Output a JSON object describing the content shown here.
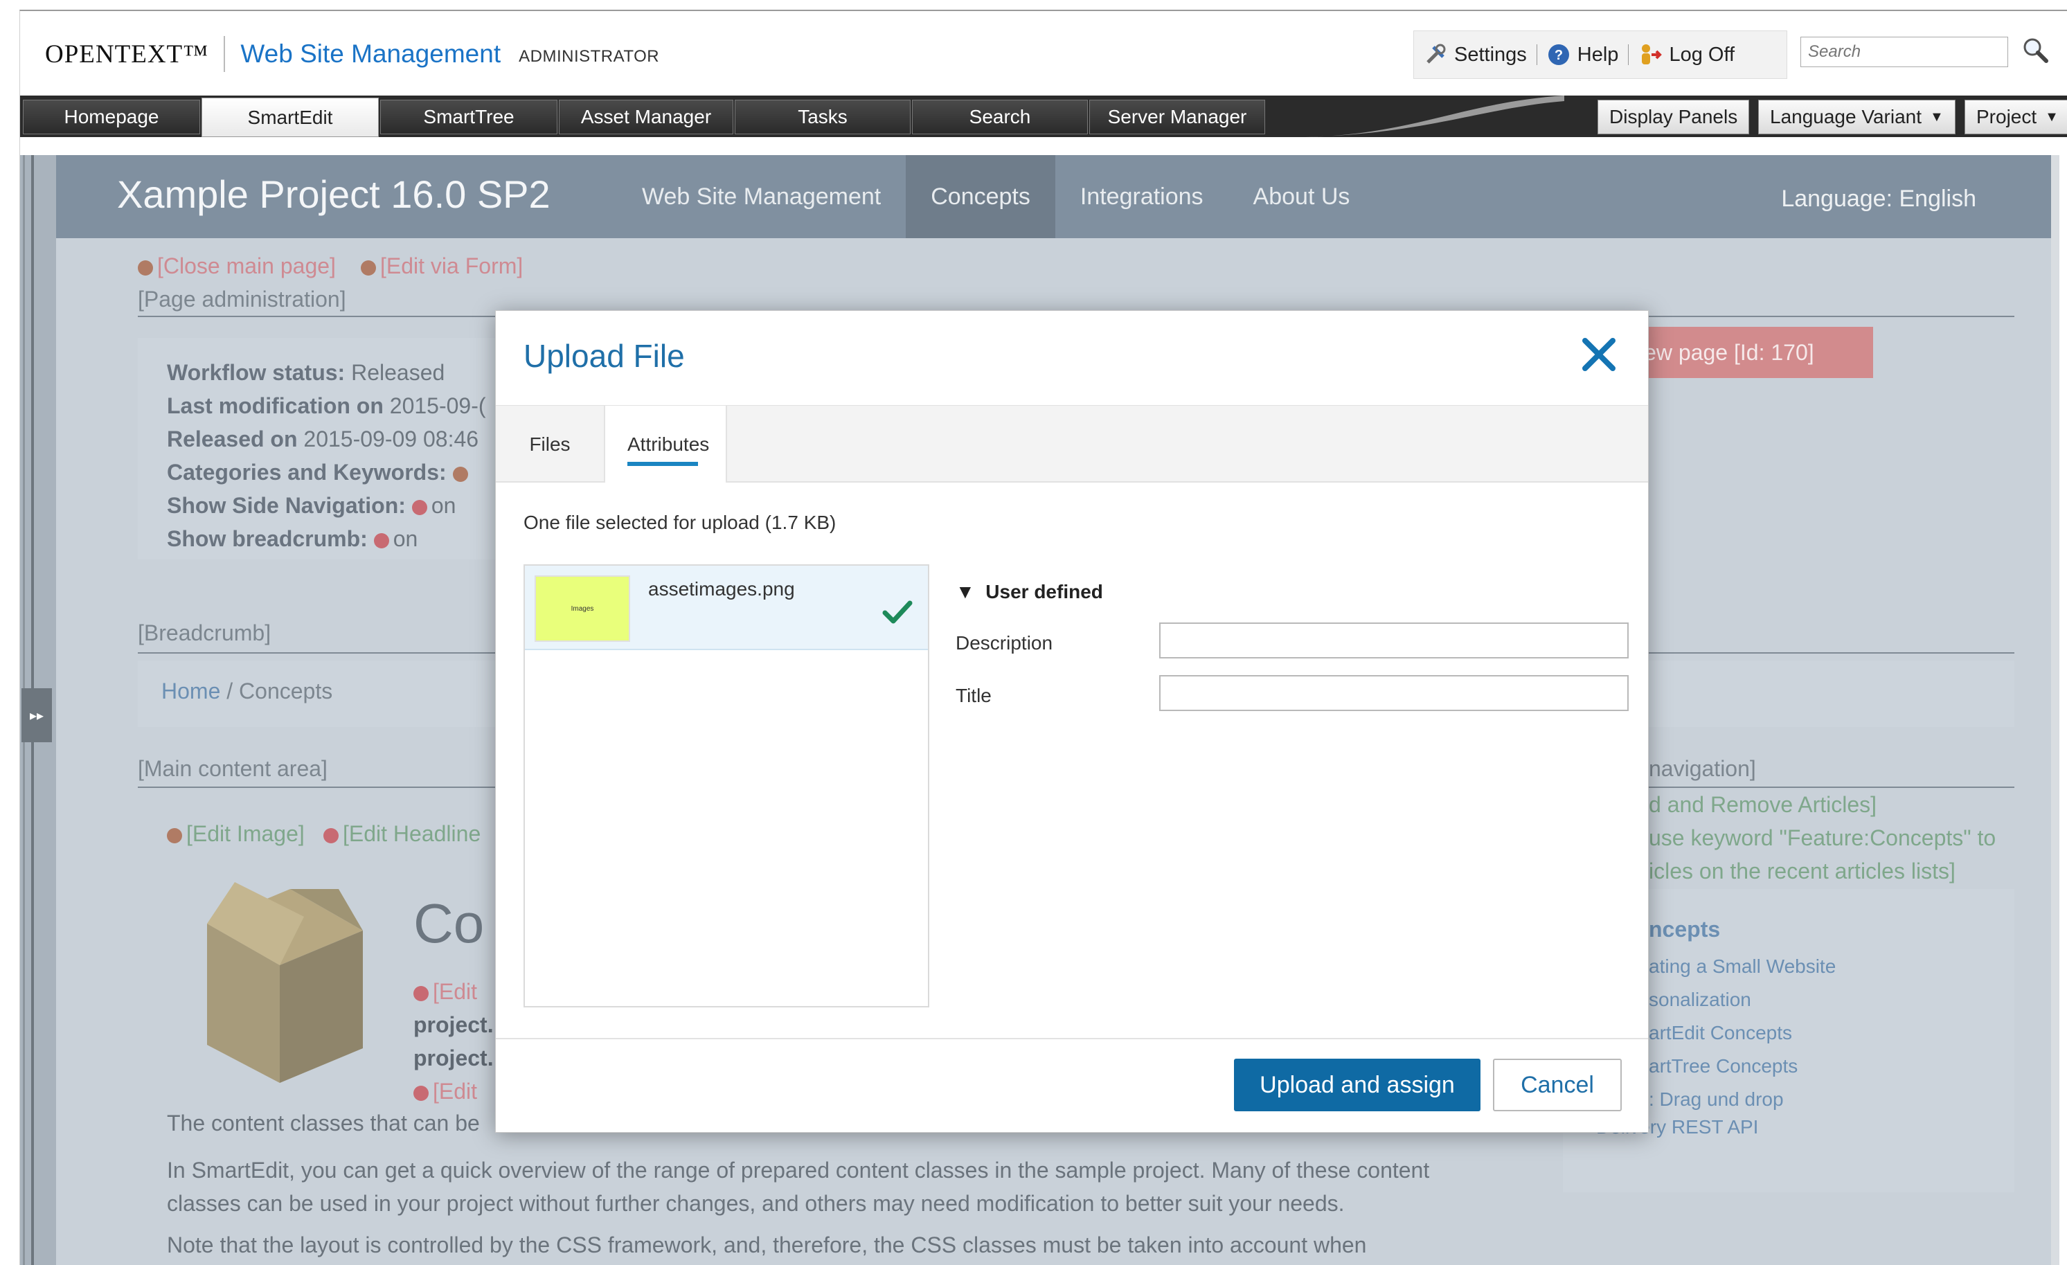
{
  "header": {
    "logo": "OPENTEXT™",
    "product": "Web Site Management",
    "role": "ADMINISTRATOR",
    "tools": [
      {
        "label": "Settings",
        "icon": "settings-icon"
      },
      {
        "label": "Help",
        "icon": "help-icon"
      },
      {
        "label": "Log Off",
        "icon": "logoff-icon"
      }
    ],
    "search_placeholder": "Search"
  },
  "tabs": [
    "Homepage",
    "SmartEdit",
    "SmartTree",
    "Asset Manager",
    "Tasks",
    "Search",
    "Server Manager"
  ],
  "active_tab": "SmartEdit",
  "right_buttons": [
    "Display Panels",
    "Language Variant",
    "Project"
  ],
  "site": {
    "title": "Xample Project 16.0 SP2",
    "nav": [
      "Web Site Management",
      "Concepts",
      "Integrations",
      "About Us"
    ],
    "active_nav": "Concepts",
    "language": "Language: English"
  },
  "page": {
    "close_main_page": "[Close main page]",
    "edit_via_form": "[Edit via Form]",
    "page_admin": "[Page administration]",
    "workflow": [
      {
        "label": "Workflow status:",
        "value": "Released"
      },
      {
        "label": "Last modification on",
        "value": "2015-09-("
      },
      {
        "label": "Released on",
        "value": "2015-09-09 08:46"
      },
      {
        "label": "Categories and Keywords:",
        "value": ""
      },
      {
        "label": "Show Side Navigation:",
        "value": "on"
      },
      {
        "label": "Show breadcrumb:",
        "value": "on"
      }
    ],
    "preview_btn": "iew page [Id: 170]",
    "breadcrumb_label": "[Breadcrumb]",
    "breadcrumb_home": "Home",
    "breadcrumb_sep": "/",
    "breadcrumb_current": "Concepts",
    "main_content_label": "[Main content area]",
    "edit_image": "[Edit Image]",
    "edit_headline": "[Edit Headline",
    "heading_partial": "Co",
    "edit_partial_1": "[Edit",
    "project_line_1": "project.",
    "project_line_2": "project.",
    "edit_partial_2": "[Edit",
    "para_1": "The content classes that can be",
    "para_2": "In SmartEdit, you can get a quick overview of the range of prepared content classes in the sample project. Many of these content classes can be used in your project without further changes, and others may need modification to better suit your needs.",
    "para_3": "Note that the layout is controlled by the CSS framework, and, therefore, the CSS classes must be taken into account when",
    "side_nav_label": "navigation]",
    "side_add_remove": "d and Remove Articles]",
    "side_use_keyword_1": "use keyword \"Feature:Concepts\" to",
    "side_use_keyword_2": "icles on the recent articles lists]",
    "side_heading": "ncepts",
    "side_links": [
      "ating a Small Website",
      "sonalization",
      "artEdit Concepts",
      "artTree Concepts",
      ": Drag und drop",
      "Delivery REST API"
    ]
  },
  "modal": {
    "title": "Upload File",
    "tabs": [
      "Files",
      "Attributes"
    ],
    "active_tab": "Attributes",
    "selection_text": "One file selected for upload (1.7 KB)",
    "file_name": "assetimages.png",
    "thumb_text": "Images",
    "group_label": "User defined",
    "fields": [
      {
        "label": "Description",
        "value": ""
      },
      {
        "label": "Title",
        "value": ""
      }
    ],
    "upload_btn": "Upload and assign",
    "cancel_btn": "Cancel"
  },
  "colors": {
    "accent": "#1f6fa8",
    "primary_button": "#0f6aa4",
    "navbar": "#8090a0",
    "content_bg": "#c9d1d9"
  }
}
